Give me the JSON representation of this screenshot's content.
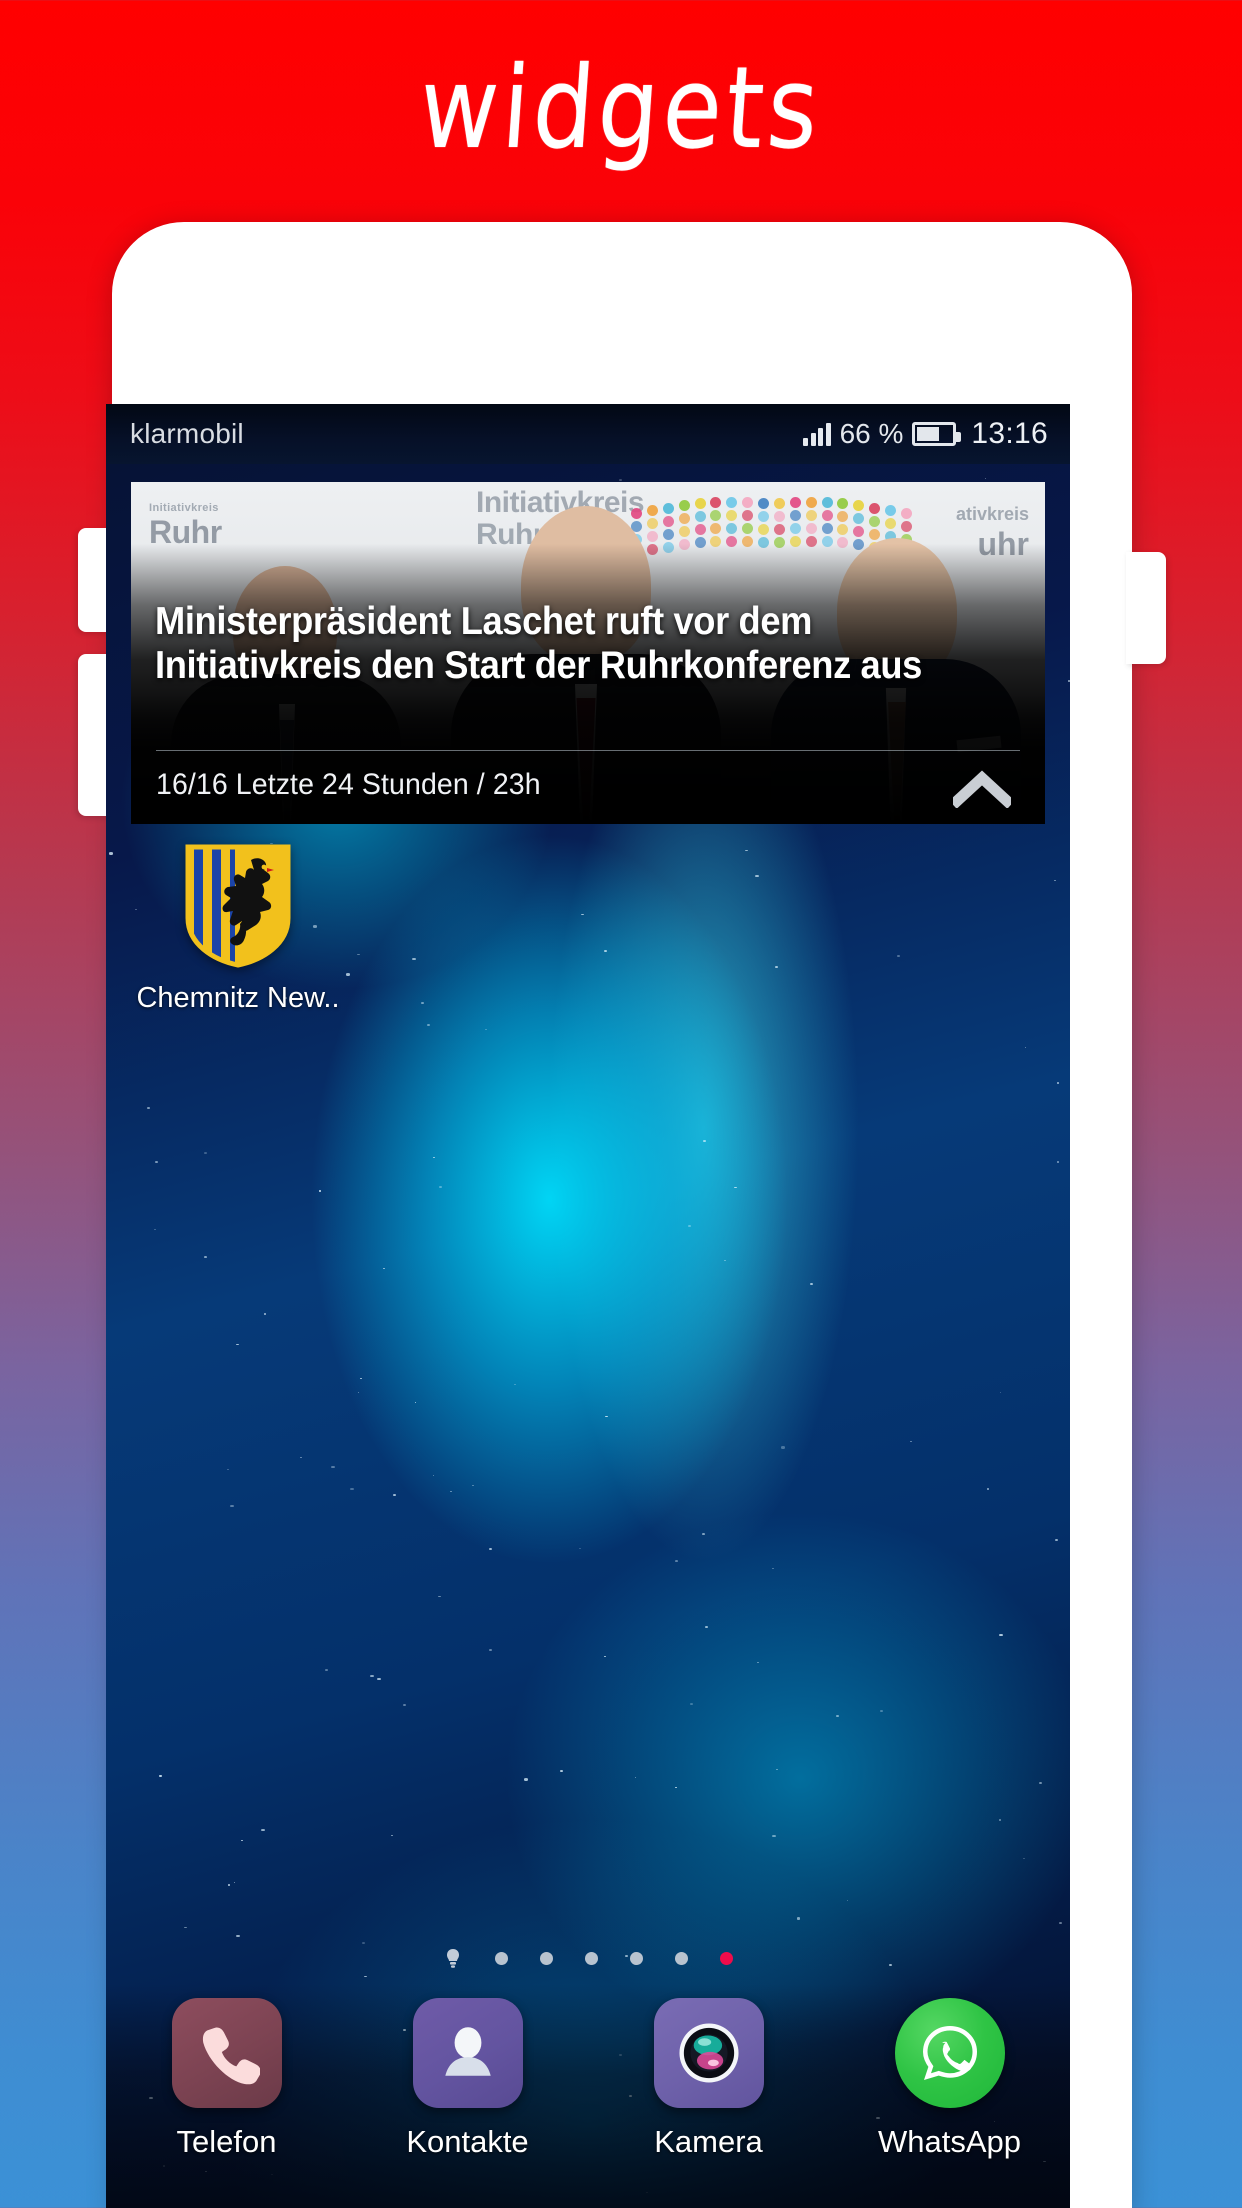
{
  "page": {
    "title": "widgets",
    "background_top_color": "#ff0000",
    "background_bottom_color": "#3b91d6"
  },
  "phone": {
    "frame_color": "#ffffff",
    "buttons": [
      {
        "name": "volume-up",
        "label": "Volume Up"
      },
      {
        "name": "volume-down",
        "label": "Volume Down"
      },
      {
        "name": "power",
        "label": "Power"
      }
    ]
  },
  "statusbar": {
    "carrier": "klarmobil",
    "battery_percent": "66 %",
    "battery_level": 66,
    "clock": "13:16",
    "signal_icon": "signal-bars-icon",
    "battery_icon": "battery-icon"
  },
  "news_widget": {
    "headline": "Ministerpräsident Laschet ruft vor dem Initiativkreis den Start der Ruhrkonferenz aus",
    "counter": "16/16",
    "timeframe": "Letzte 24 Stunden / 23h",
    "meta_line": "16/16  Letzte 24 Stunden / 23h",
    "collapse_icon": "chevron-up-icon",
    "backdrop_text": {
      "left_small": "Initiativkreis",
      "left_big": "Ruhr",
      "center_line1": "Initiativkreis",
      "center_line2": "Ruhr",
      "right_small": "ativkreis",
      "right_big": "uhr"
    }
  },
  "home_app": {
    "label": "Chemnitz New..",
    "icon": "chemnitz-crest-icon"
  },
  "page_indicator": {
    "total": 7,
    "active_index": 6,
    "first_is_home": true,
    "active_color": "#ef0c4b",
    "inactive_color": "#b8c3cf"
  },
  "dock": {
    "items": [
      {
        "label": "Telefon",
        "icon": "phone-icon",
        "color": "#7c4352"
      },
      {
        "label": "Kontakte",
        "icon": "contact-icon",
        "color": "#6354a0"
      },
      {
        "label": "Kamera",
        "icon": "camera-icon",
        "color": "#6e61aa"
      },
      {
        "label": "WhatsApp",
        "icon": "whatsapp-icon",
        "color": "#2fc445"
      }
    ]
  }
}
